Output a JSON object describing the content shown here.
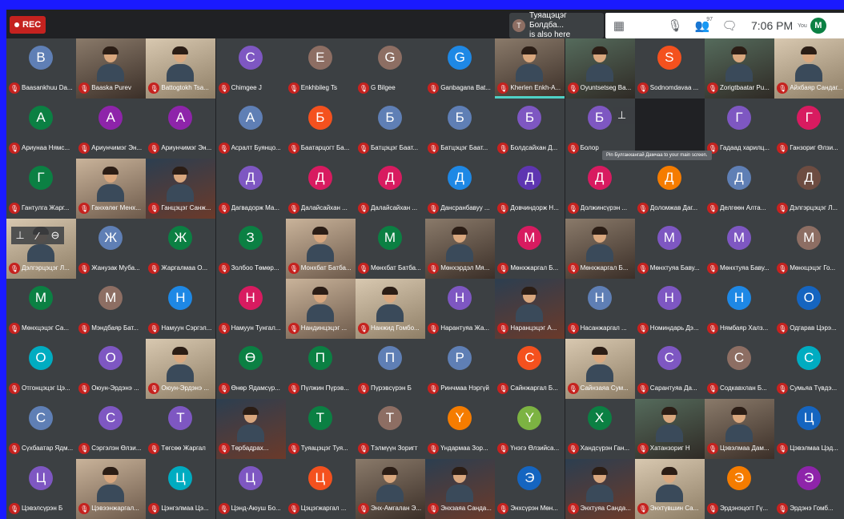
{
  "recording": {
    "label": "REC"
  },
  "notification": {
    "initial": "T",
    "line1": "Туяацэцэг Болдба...",
    "line2": "is also here"
  },
  "toolbar": {
    "participant_count": "97",
    "time": "7:06 PM",
    "you_label": "You",
    "user_initial": "M"
  },
  "tooltip": "Pin Булганхангай Дамчаа to your main screen.",
  "colors": {
    "blue_border": "#1a1aff",
    "mute_red": "#c5221f",
    "tile_bg": "#3c4043"
  },
  "tiles": [
    {
      "name": "Baasankhuu Da...",
      "initial": "B",
      "color": "#5f7fb5"
    },
    {
      "name": "Baaska Purev",
      "initial": "",
      "video": "v2"
    },
    {
      "name": "Battogtokh Tsa...",
      "initial": "",
      "video": "v4"
    },
    {
      "name": "Chimgee J",
      "initial": "C",
      "color": "#7e57c2"
    },
    {
      "name": "Enkhbileg Ts",
      "initial": "E",
      "color": "#8d6e63"
    },
    {
      "name": "G Bilgee",
      "initial": "G",
      "color": "#8d6e63"
    },
    {
      "name": "Ganbagana Bat...",
      "initial": "G",
      "color": "#1e88e5"
    },
    {
      "name": "Kherlen Enkh-A...",
      "initial": "",
      "video": "v2",
      "speaking": true
    },
    {
      "name": "Oyuntsetseg Ba...",
      "initial": "",
      "video": "v5"
    },
    {
      "name": "Sodnomdavaa ...",
      "initial": "S",
      "color": "#f4511e"
    },
    {
      "name": "Zorigtbaatar Pu...",
      "initial": "",
      "video": "v5"
    },
    {
      "name": "Айхбаяр Сандаг...",
      "initial": "",
      "video": "v4"
    },
    {
      "name": "Ариунаа Нямс...",
      "initial": "A",
      "color": "#0b8043"
    },
    {
      "name": "Ариунчимэг Эн...",
      "initial": "A",
      "color": "#8e24aa"
    },
    {
      "name": "Ариунчимэг Эн...",
      "initial": "A",
      "color": "#8e24aa"
    },
    {
      "name": "Асралт Буянцо...",
      "initial": "A",
      "color": "#5f7fb5"
    },
    {
      "name": "Баатарцогт Ба...",
      "initial": "Б",
      "color": "#f4511e"
    },
    {
      "name": "Батцэцэг Баат...",
      "initial": "Б",
      "color": "#5f7fb5"
    },
    {
      "name": "Батцэцэг Баат...",
      "initial": "Б",
      "color": "#5f7fb5"
    },
    {
      "name": "Болдсайхан Д...",
      "initial": "Б",
      "color": "#7e57c2"
    },
    {
      "name": "Болор",
      "initial": "Б",
      "color": "#7e57c2",
      "hover": true
    },
    {
      "name": "",
      "initial": "",
      "color": "#3c4043",
      "hidden": true
    },
    {
      "name": "Гадаад харилц...",
      "initial": "Г",
      "color": "#7e57c2"
    },
    {
      "name": "Ганзориг Өлзи...",
      "initial": "Г",
      "color": "#d81b60"
    },
    {
      "name": "Гантулга Жарг...",
      "initial": "Г",
      "color": "#0b8043"
    },
    {
      "name": "Ганхөлөг Менх...",
      "initial": "",
      "video": "v1"
    },
    {
      "name": "Ганцэцэг Санж...",
      "initial": "",
      "video": "v3"
    },
    {
      "name": "Дагвадорж Ма...",
      "initial": "Д",
      "color": "#7e57c2"
    },
    {
      "name": "Далайсайхан ...",
      "initial": "Д",
      "color": "#d81b60"
    },
    {
      "name": "Далайсайхан ...",
      "initial": "Д",
      "color": "#d81b60"
    },
    {
      "name": "Дансранбавуу ...",
      "initial": "Д",
      "color": "#1e88e5"
    },
    {
      "name": "Довчиндорж Н...",
      "initial": "Д",
      "color": "#5e35b1"
    },
    {
      "name": "Должинсүрэн ...",
      "initial": "Д",
      "color": "#d81b60"
    },
    {
      "name": "Доломжав Даг...",
      "initial": "Д",
      "color": "#f57c00"
    },
    {
      "name": "Делгөөн Алта...",
      "initial": "Д",
      "color": "#5f7fb5"
    },
    {
      "name": "Дэлгэрцэцэг Л...",
      "initial": "Д",
      "color": "#6d4c41"
    },
    {
      "name": "Дэлгэрцэцэг Л...",
      "initial": "",
      "video": "v4",
      "hover2": true
    },
    {
      "name": "Жанузак Муба...",
      "initial": "Ж",
      "color": "#5f7fb5"
    },
    {
      "name": "Жаргалмаа О...",
      "initial": "Ж",
      "color": "#0b8043"
    },
    {
      "name": "Золбоо Төмөр...",
      "initial": "З",
      "color": "#0b8043"
    },
    {
      "name": "Монхбат Батба...",
      "initial": "",
      "video": "v1"
    },
    {
      "name": "Мөнхбат Батба...",
      "initial": "M",
      "color": "#0b8043"
    },
    {
      "name": "Мөнхэрдэл Мя...",
      "initial": "",
      "video": "v2"
    },
    {
      "name": "Мөнхжаргал Б...",
      "initial": "M",
      "color": "#d81b60"
    },
    {
      "name": "Мөнхжаргал Б...",
      "initial": "",
      "video": "v2"
    },
    {
      "name": "Мөнхтуяа Баву...",
      "initial": "M",
      "color": "#7e57c2"
    },
    {
      "name": "Мөнхтуяа Баву...",
      "initial": "M",
      "color": "#7e57c2"
    },
    {
      "name": "Мөнхцэцэг Го...",
      "initial": "M",
      "color": "#8d6e63"
    },
    {
      "name": "Мөнхцэцэг Са...",
      "initial": "M",
      "color": "#0b8043"
    },
    {
      "name": "Мэндбаяр Бат...",
      "initial": "M",
      "color": "#8d6e63"
    },
    {
      "name": "Намуун Сэргэл...",
      "initial": "H",
      "color": "#1e88e5"
    },
    {
      "name": "Намуун Тунгал...",
      "initial": "H",
      "color": "#d81b60"
    },
    {
      "name": "Нандинцэцэг ...",
      "initial": "",
      "video": "v1"
    },
    {
      "name": "Нанжид Гомбо...",
      "initial": "",
      "video": "v4"
    },
    {
      "name": "Нарантуяа Жа...",
      "initial": "H",
      "color": "#7e57c2"
    },
    {
      "name": "Наранцэцэг А...",
      "initial": "",
      "video": "v3"
    },
    {
      "name": "Насанжаргал ...",
      "initial": "H",
      "color": "#5f7fb5"
    },
    {
      "name": "Номиндарь Дэ...",
      "initial": "H",
      "color": "#7e57c2"
    },
    {
      "name": "Нямбаяр Халз...",
      "initial": "H",
      "color": "#1e88e5"
    },
    {
      "name": "Одгарав Цэрэ...",
      "initial": "O",
      "color": "#1565c0"
    },
    {
      "name": "Отгонцэцэг Цэ...",
      "initial": "O",
      "color": "#00acc1"
    },
    {
      "name": "Оюун-Эрдэнэ ...",
      "initial": "O",
      "color": "#7e57c2"
    },
    {
      "name": "Оюун-Эрдэнэ ...",
      "initial": "",
      "video": "v4"
    },
    {
      "name": "Өнөр Ядамсүр...",
      "initial": "Ө",
      "color": "#0b8043"
    },
    {
      "name": "Пүлжин Пүрэв...",
      "initial": "П",
      "color": "#0b8043"
    },
    {
      "name": "Пүрэвсүрэн Б",
      "initial": "П",
      "color": "#5f7fb5"
    },
    {
      "name": "Ринчмаа Нэргүй",
      "initial": "P",
      "color": "#5f7fb5"
    },
    {
      "name": "Сайнжаргал Б...",
      "initial": "C",
      "color": "#f4511e"
    },
    {
      "name": "Сайнзаяа Сум...",
      "initial": "",
      "video": "v4"
    },
    {
      "name": "Сарантуяа Да...",
      "initial": "C",
      "color": "#7e57c2"
    },
    {
      "name": "Содкавхлан Б...",
      "initial": "C",
      "color": "#8d6e63"
    },
    {
      "name": "Сумьяа Түвдэ...",
      "initial": "C",
      "color": "#00acc1"
    },
    {
      "name": "Сүхбаатар Ядм...",
      "initial": "C",
      "color": "#5f7fb5"
    },
    {
      "name": "Сэргэлэн Өлзи...",
      "initial": "C",
      "color": "#7e57c2"
    },
    {
      "name": "Төгсөө Жаргал",
      "initial": "T",
      "color": "#7e57c2"
    },
    {
      "name": "Төрбадрах...",
      "initial": "",
      "video": "v3"
    },
    {
      "name": "Туяацэцэг Туя...",
      "initial": "T",
      "color": "#0b8043"
    },
    {
      "name": "Тэлмүүн Зоригт",
      "initial": "T",
      "color": "#8d6e63"
    },
    {
      "name": "Үндармаа Зор...",
      "initial": "Y",
      "color": "#f57c00"
    },
    {
      "name": "Үнэгэ Өлзийса...",
      "initial": "Y",
      "color": "#7cb342"
    },
    {
      "name": "Хандсүрэн Ган...",
      "initial": "X",
      "color": "#0b8043"
    },
    {
      "name": "Хатанзориг Н",
      "initial": "",
      "video": "v5"
    },
    {
      "name": "Цэвэлмаа Дам...",
      "initial": "",
      "video": "v2"
    },
    {
      "name": "Цэвэлмаа Цэд...",
      "initial": "Ц",
      "color": "#1565c0"
    },
    {
      "name": "Цэвэлсүрэн Б",
      "initial": "Ц",
      "color": "#7e57c2"
    },
    {
      "name": "Цэвээнжаргал...",
      "initial": "",
      "video": "v1"
    },
    {
      "name": "Цэнгэлмаа Цэ...",
      "initial": "Ц",
      "color": "#00acc1"
    },
    {
      "name": "Цэнд-Аюуш Бо...",
      "initial": "Ц",
      "color": "#7e57c2"
    },
    {
      "name": "Цэцэгжаргал ...",
      "initial": "Ц",
      "color": "#f4511e"
    },
    {
      "name": "Энх-Амгалан Э...",
      "initial": "",
      "video": "v2"
    },
    {
      "name": "Энхзаяа Санда...",
      "initial": "",
      "video": "v3"
    },
    {
      "name": "Энхсүрэн Мөн...",
      "initial": "Э",
      "color": "#1565c0"
    },
    {
      "name": "Энхтуяа Санда...",
      "initial": "",
      "video": "v3"
    },
    {
      "name": "Энхтүвшин Са...",
      "initial": "",
      "video": "v4"
    },
    {
      "name": "Эрдэнэцогт Гү...",
      "initial": "Э",
      "color": "#f57c00"
    },
    {
      "name": "Эрдэнэ Гомб...",
      "initial": "Э",
      "color": "#8e24aa"
    }
  ]
}
